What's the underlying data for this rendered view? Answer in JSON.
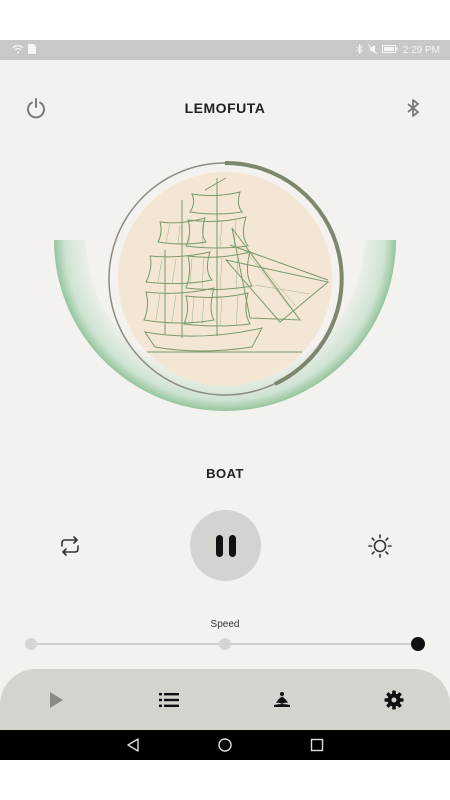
{
  "status_bar": {
    "time": "2:29 PM",
    "icons": [
      "wifi-icon",
      "sim-icon",
      "bluetooth-icon",
      "mute-icon",
      "battery-icon"
    ]
  },
  "header": {
    "title": "LEMOFUTA",
    "power_icon": "power-icon",
    "bluetooth_icon": "bluetooth-icon"
  },
  "player": {
    "artwork_icon": "sailing-ship-illustration",
    "progress": 0.32,
    "track_name": "BOAT",
    "loop_icon": "repeat-icon",
    "play_pause_icon": "pause-icon",
    "brightness_icon": "brightness-icon"
  },
  "speed": {
    "label": "Speed",
    "levels": 3,
    "selected_level": 3
  },
  "bottom_nav": {
    "items": [
      "play-icon",
      "list-icon",
      "lotus-icon",
      "settings-icon"
    ]
  },
  "colors": {
    "background": "#f3f2ee",
    "accent_green": "#8fc299",
    "ring_progress": "#7d8670",
    "artwork_bg": "#f4e6d5",
    "ship_line": "#7a9a6a"
  }
}
